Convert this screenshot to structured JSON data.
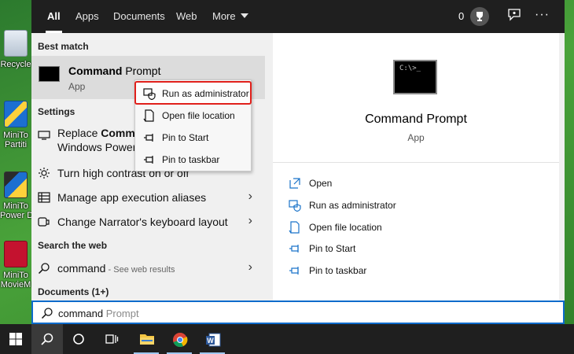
{
  "desktop": {
    "icons": [
      {
        "label": "Recycle",
        "icon": "recycle-bin-icon"
      },
      {
        "label": "MiniTo",
        "label2": "Partiti",
        "icon": "minitool-partition-icon"
      },
      {
        "label": "MiniTo",
        "label2": "Power D",
        "icon": "minitool-power-icon"
      },
      {
        "label": "MiniTo",
        "label2": "MovieM",
        "icon": "minitool-moviemaker-icon"
      }
    ]
  },
  "topbar": {
    "tabs": [
      "All",
      "Apps",
      "Documents",
      "Web",
      "More"
    ],
    "active_tab": "All",
    "points": "0"
  },
  "sections": {
    "best_match": "Best match",
    "settings": "Settings",
    "search_web": "Search the web",
    "documents": "Documents (1+)"
  },
  "best_match": {
    "title_bold": "Command",
    "title_rest": " Prompt",
    "subtitle": "App"
  },
  "settings_items": {
    "replace_line1_a": "Replace ",
    "replace_line1_b": "Comman",
    "replace_line2": "Windows PowerS",
    "contrast": "Turn high contrast on or off",
    "aliases": "Manage app execution aliases",
    "narrator": "Change Narrator's keyboard layout"
  },
  "web_result": {
    "query": "command",
    "suffix": " - See web results"
  },
  "context_menu": {
    "items": [
      "Run as administrator",
      "Open file location",
      "Pin to Start",
      "Pin to taskbar"
    ],
    "highlight_color": "#e0201b"
  },
  "detail": {
    "title": "Command Prompt",
    "subtitle": "App",
    "actions": [
      "Open",
      "Run as administrator",
      "Open file location",
      "Pin to Start",
      "Pin to taskbar"
    ]
  },
  "search": {
    "typed": "command",
    "completion": " Prompt"
  },
  "taskbar": {
    "items": [
      "windows-start-icon",
      "search-icon",
      "cortana-icon",
      "task-view-icon",
      "file-explorer-icon",
      "chrome-icon",
      "word-icon"
    ]
  },
  "colors": {
    "accent": "#0b6bcb",
    "icon_blue": "#1a73c9"
  }
}
